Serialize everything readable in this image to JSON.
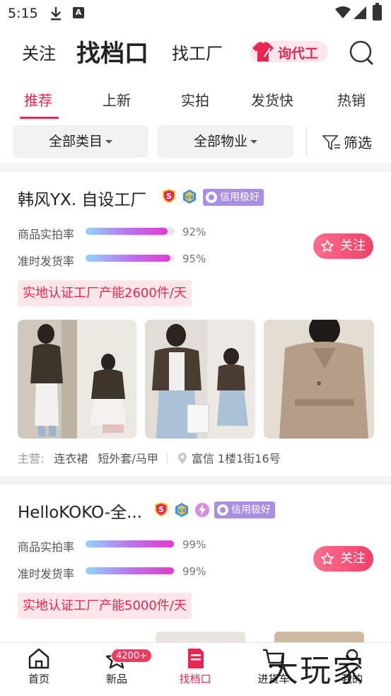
{
  "status_bar": {
    "time": "5:15"
  },
  "top_nav": {
    "follow": "关注",
    "find_stall": "找档口",
    "find_factory": "找工厂",
    "inquiry_label": "询代工"
  },
  "tabs": [
    "推荐",
    "上新",
    "实拍",
    "发货快",
    "热销"
  ],
  "filters": {
    "category": "全部类目",
    "property": "全部物业",
    "screen": "筛选"
  },
  "cards": [
    {
      "title": "韩风YX. 自设工厂",
      "credit": "信用极好",
      "metrics": [
        {
          "label": "商品实拍率",
          "value": "92%",
          "fill": 0.92
        },
        {
          "label": "准时发货率",
          "value": "95%",
          "fill": 0.95
        }
      ],
      "follow": "关注",
      "cert": "实地认证工厂产能2600件/天",
      "main_label": "主营:",
      "main_items": [
        "连衣裙",
        "短外套/马甲"
      ],
      "location": "富信 1楼1街16号"
    },
    {
      "title": "HelloKOKO-全...",
      "credit": "信用极好",
      "metrics": [
        {
          "label": "商品实拍率",
          "value": "99%",
          "fill": 0.99
        },
        {
          "label": "准时发货率",
          "value": "99%",
          "fill": 0.99
        }
      ],
      "follow": "关注",
      "cert": "实地认证工厂产能5000件/天"
    }
  ],
  "bottom_nav": {
    "home": "首页",
    "new": "新品",
    "new_badge": "4200+",
    "stall": "找档口",
    "cart": "进货车",
    "mine": "我的"
  },
  "watermark": "大玩家",
  "colors": {
    "accent": "#e8264f",
    "credit": "#a98ee6"
  }
}
